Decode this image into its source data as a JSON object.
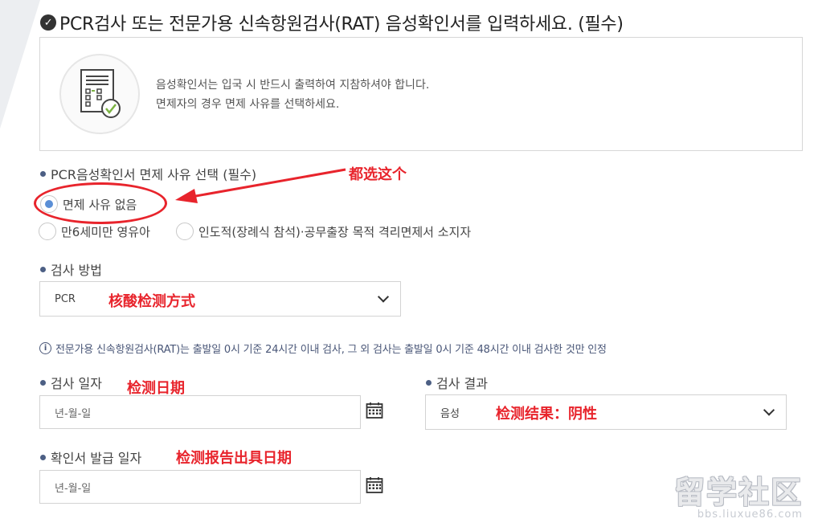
{
  "title": "PCR검사 또는 전문가용 신속항원검사(RAT) 음성확인서를 입력하세요. (필수)",
  "info": {
    "line1": "음성확인서는 입국 시 반드시 출력하여 지참하셔야 합니다.",
    "line2": "면제자의 경우 면제 사유를 선택하세요."
  },
  "exemption": {
    "label": "PCR음성확인서 면제 사유 선택 (필수)",
    "options": [
      {
        "label": "면제 사유 없음",
        "checked": true
      },
      {
        "label": "만6세미만 영유아",
        "checked": false
      },
      {
        "label": "인도적(장례식 참석)·공무출장 목적 격리면제서 소지자",
        "checked": false
      }
    ]
  },
  "test_method": {
    "label": "검사 방법",
    "value": "PCR"
  },
  "notice": "전문가용 신속항원검사(RAT)는 출발일 0시 기준 24시간 이내 검사, 그 외 검사는 출발일 0시 기준 48시간 이내 검사한 것만 인정",
  "test_date": {
    "label": "검사 일자",
    "placeholder": "년-월-일"
  },
  "test_result": {
    "label": "검사 결과",
    "value": "음성"
  },
  "issue_date": {
    "label": "확인서 발급 일자",
    "placeholder": "년-월-일"
  },
  "annotations": {
    "select_all": "都选这个",
    "method": "核酸检测方式",
    "test_date": "检测日期",
    "result": "检测结果：阴性",
    "issue_date": "检测报告出具日期"
  },
  "watermark": {
    "logo": "留学社区",
    "url": "bbs.liuxue86.com"
  },
  "colors": {
    "accent": "#4c5f84",
    "annotation": "#e8242c",
    "radio_selected": "#5b8fd6"
  }
}
